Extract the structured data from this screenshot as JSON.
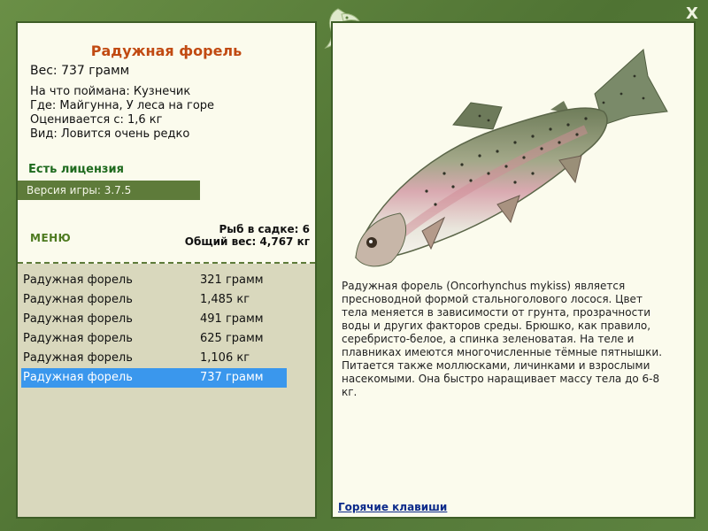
{
  "window": {
    "close_label": "X"
  },
  "fish": {
    "title": "Радужная форель",
    "weight": "Вес: 737 грамм",
    "details": [
      "На что поймана: Кузнечик",
      "Где: Майгунна, У леса на горе",
      "Оценивается с: 1,6 кг",
      "Вид: Ловится очень редко"
    ],
    "description": "Радужная форель (Oncorhynchus mykiss) является пресноводной формой стальноголового лосося. Цвет тела меняется в зависимости от грунта, прозрачности воды и других факторов среды. Брюшко, как правило, серебристо-белое, а спинка зеленоватая. На теле и плавниках имеются многочисленные тёмные пятнышки. Питается также моллюсками, личинками и взрослыми насекомыми. Она быстро наращивает массу тела до 6-8 кг."
  },
  "license": "Есть лицензия",
  "version": "Версия игры: 3.7.5",
  "menu_label": "МЕНЮ",
  "stats": {
    "fish_in_keepnet": "Рыб в садке: 6",
    "total_weight": "Общий вес: 4,767 кг"
  },
  "catch_list": [
    {
      "name": "Радужная форель",
      "weight": "321 грамм"
    },
    {
      "name": "Радужная форель",
      "weight": "1,485 кг"
    },
    {
      "name": "Радужная форель",
      "weight": "491 грамм"
    },
    {
      "name": "Радужная форель",
      "weight": "625 грамм"
    },
    {
      "name": "Радужная форель",
      "weight": "1,106 кг"
    },
    {
      "name": "Радужная форель",
      "weight": "737 грамм",
      "selected": true
    }
  ],
  "hotkeys_label": "Горячие клавиши",
  "colors": {
    "frame": "#5a7f3c",
    "panel": "#fbfbed",
    "title": "#c14a12",
    "selection": "#3a97ed"
  },
  "icons": {
    "logo": "fish-logo-icon",
    "close": "close-icon"
  }
}
